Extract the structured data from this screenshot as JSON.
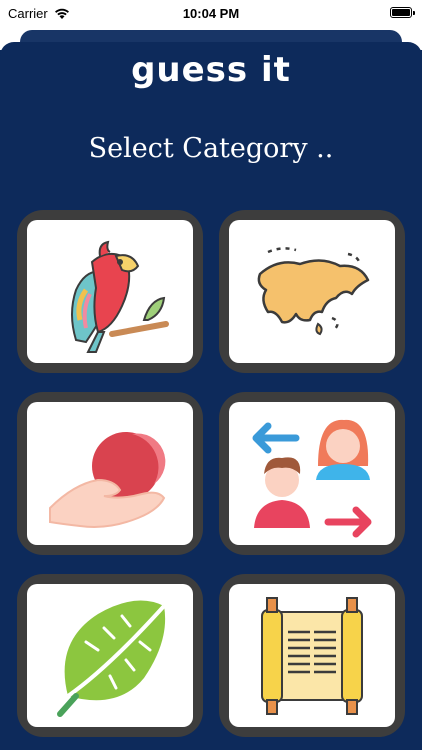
{
  "status_bar": {
    "carrier": "Carrier",
    "time": "10:04 PM"
  },
  "header": {
    "title": "guess it",
    "subtitle": "Select Category .."
  },
  "categories": [
    {
      "icon": "parrot-icon"
    },
    {
      "icon": "world-map-icon"
    },
    {
      "icon": "hand-ball-icon"
    },
    {
      "icon": "people-exchange-icon"
    },
    {
      "icon": "leaf-icon"
    },
    {
      "icon": "scroll-icon"
    }
  ],
  "colors": {
    "background": "#0d2a5b",
    "card_frame": "#3d3d3d",
    "card_face": "#ffffff"
  }
}
